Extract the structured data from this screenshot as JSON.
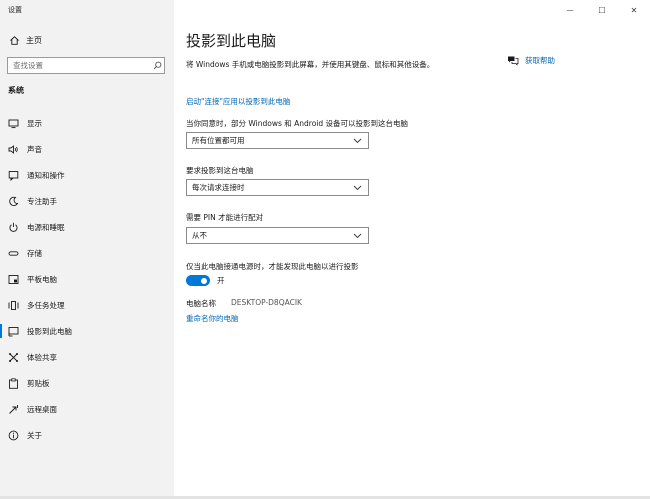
{
  "app": {
    "title": "设置"
  },
  "window_controls": {
    "minimize": "—",
    "maximize": "☐",
    "close": "✕"
  },
  "sidebar": {
    "home_label": "主页",
    "search_placeholder": "查找设置",
    "section_label": "系统",
    "items": [
      {
        "label": "显示",
        "icon": "display-icon"
      },
      {
        "label": "声音",
        "icon": "sound-icon"
      },
      {
        "label": "通知和操作",
        "icon": "notifications-icon"
      },
      {
        "label": "专注助手",
        "icon": "focus-assist-icon"
      },
      {
        "label": "电源和睡眠",
        "icon": "power-icon"
      },
      {
        "label": "存储",
        "icon": "storage-icon"
      },
      {
        "label": "平板电脑",
        "icon": "tablet-icon"
      },
      {
        "label": "多任务处理",
        "icon": "multitasking-icon"
      },
      {
        "label": "投影到此电脑",
        "icon": "project-icon",
        "selected": true
      },
      {
        "label": "体验共享",
        "icon": "shared-experiences-icon"
      },
      {
        "label": "剪贴板",
        "icon": "clipboard-icon"
      },
      {
        "label": "远程桌面",
        "icon": "remote-desktop-icon"
      },
      {
        "label": "关于",
        "icon": "about-icon"
      }
    ]
  },
  "main": {
    "title": "投影到此电脑",
    "description": "将 Windows 手机或电脑投影到此屏幕，并使用其键盘、鼠标和其他设备。",
    "help_link": "获取帮助",
    "connect_link": "启动\"连接\"应用以投影到此电脑",
    "setting1": {
      "label": "当你同意时，部分 Windows 和 Android 设备可以投影到这台电脑",
      "value": "所有位置都可用"
    },
    "setting2": {
      "label": "要求投影到这台电脑",
      "value": "每次请求连接时"
    },
    "setting3": {
      "label": "需要 PIN 才能进行配对",
      "value": "从不"
    },
    "setting4": {
      "label": "仅当此电脑接通电源时，才能发现此电脑以进行投影",
      "toggle_state": "开",
      "on": true
    },
    "pc_name_label": "电脑名称",
    "pc_name_value": "DESKTOP-D8QACIK",
    "rename_link": "重命名你的电脑"
  },
  "colors": {
    "accent": "#0078d7",
    "link": "#0067b8",
    "sidebar_bg": "#f2f2f2"
  }
}
